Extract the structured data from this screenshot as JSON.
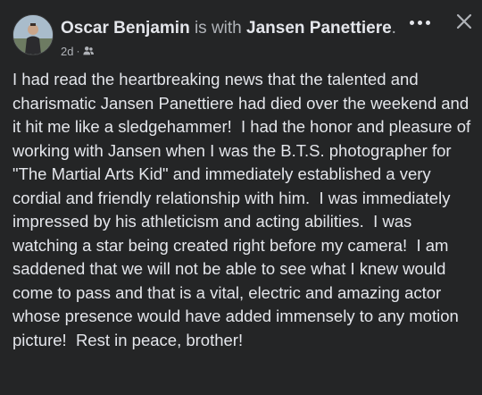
{
  "post": {
    "author": "Oscar Benjamin",
    "with_text": "is with",
    "tagged": "Jansen Panettiere",
    "period": ".",
    "time": "2d",
    "dot": "·",
    "audience_icon": "friends-icon",
    "more_icon": "more-options-icon",
    "close_icon": "close-icon",
    "body": "I had read the heartbreaking news that the talented and charismatic Jansen Panettiere had died over the weekend and it hit me like a sledgehammer!  I had the honor and pleasure of working with Jansen when I was the B.T.S. photographer for \"The Martial Arts Kid\" and immediately established a very cordial and friendly relationship with him.  I was immediately impressed by his athleticism and acting abilities.  I was watching a star being created right before my camera!  I am saddened that we will not be able to see what I knew would come to pass and that is a vital, electric and amazing actor whose presence would have added immensely to any motion picture!  Rest in peace, brother!"
  },
  "colors": {
    "background": "#242526",
    "primary_text": "#e4e6eb",
    "secondary_text": "#b0b3b8"
  }
}
